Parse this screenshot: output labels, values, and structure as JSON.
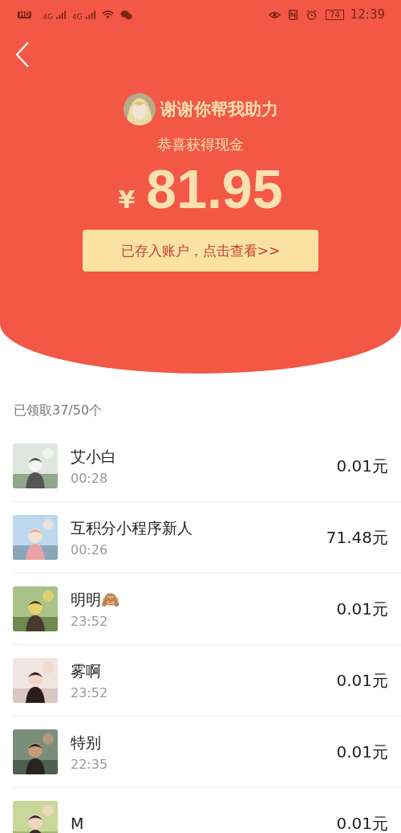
{
  "status_bar": {
    "hd": "HD",
    "networks": [
      "4G",
      "4G"
    ],
    "battery": "74",
    "time": "12:39"
  },
  "header": {
    "title": "谢谢你帮我助力",
    "subtitle": "恭喜获得现金",
    "currency": "¥",
    "amount": "81.95",
    "button": "已存入账户，点击查看>>"
  },
  "summary": "已领取37/50个",
  "records": [
    {
      "name": "艾小白",
      "time": "00:28",
      "amount": "0.01元"
    },
    {
      "name": "互积分小程序新人",
      "time": "00:26",
      "amount": "71.48元"
    },
    {
      "name": "明明🙈",
      "time": "23:52",
      "amount": "0.01元"
    },
    {
      "name": "雾啊",
      "time": "23:52",
      "amount": "0.01元"
    },
    {
      "name": "特别",
      "time": "22:35",
      "amount": "0.01元"
    },
    {
      "name": "M",
      "amount": "0.01元"
    }
  ]
}
